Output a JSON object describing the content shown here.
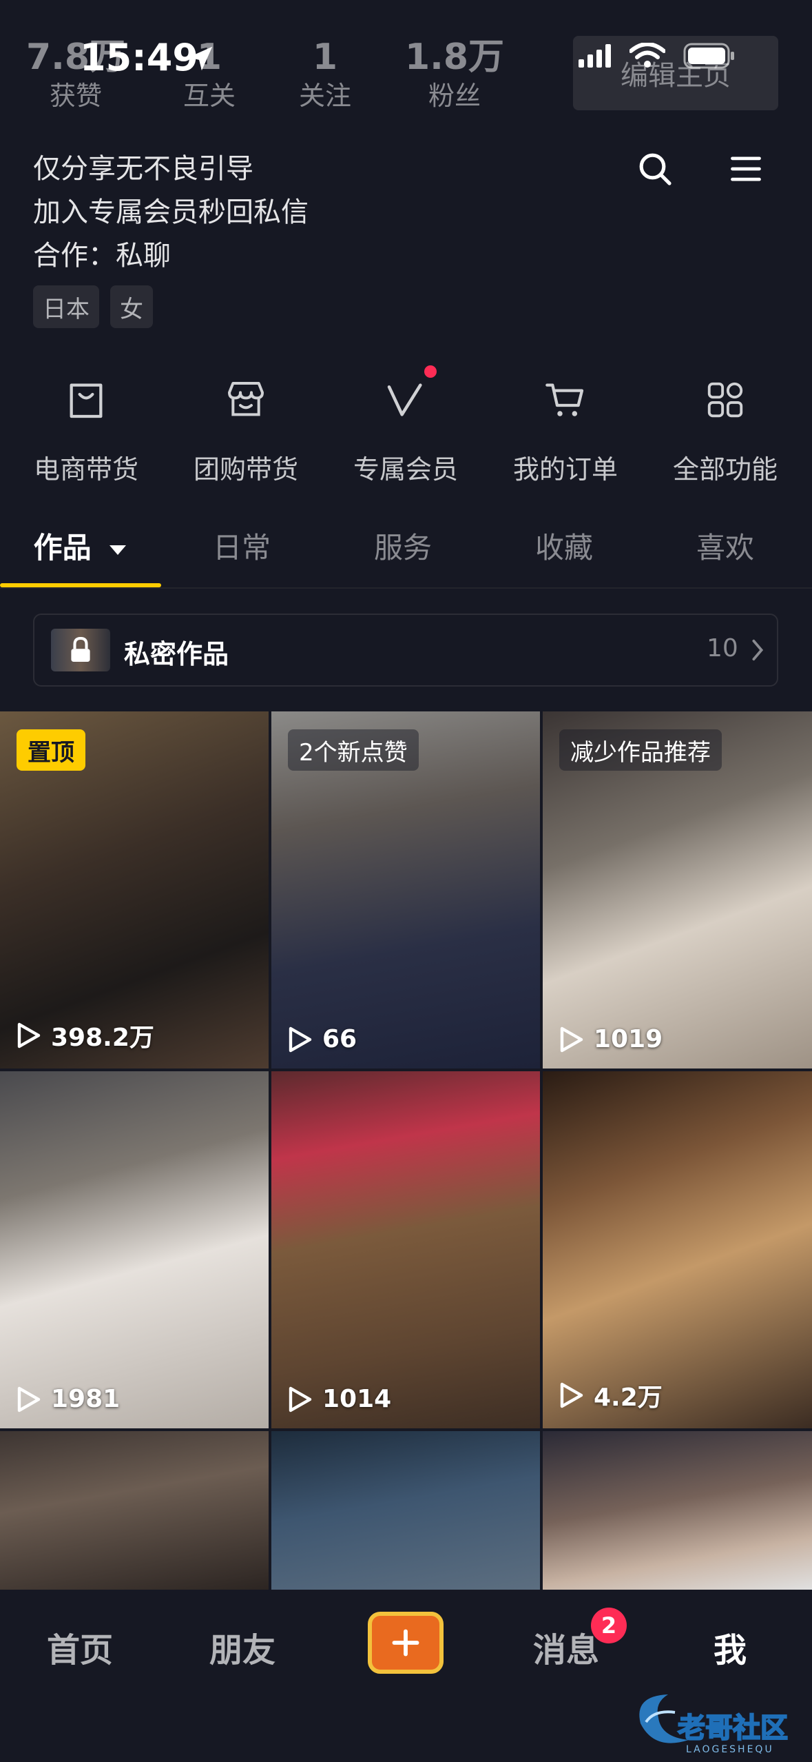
{
  "status_bar": {
    "time": "15:49"
  },
  "stats": [
    {
      "num": "7.8万",
      "label": "获赞"
    },
    {
      "num": "1",
      "label": "互关"
    },
    {
      "num": "1",
      "label": "关注"
    },
    {
      "num": "1.8万",
      "label": "粉丝"
    }
  ],
  "edit_button": "编辑主页",
  "bio": {
    "lines": [
      "仅分享无不良引导",
      "加入专属会员秒回私信",
      "合作：私聊"
    ],
    "tags": [
      "日本",
      "女"
    ]
  },
  "features": [
    {
      "label": "电商带货",
      "icon": "shopping-bag-icon"
    },
    {
      "label": "团购带货",
      "icon": "store-icon"
    },
    {
      "label": "专属会员",
      "icon": "vip-icon"
    },
    {
      "label": "我的订单",
      "icon": "cart-icon"
    },
    {
      "label": "全部功能",
      "icon": "grid-icon"
    }
  ],
  "tabs": [
    "作品",
    "日常",
    "服务",
    "收藏",
    "喜欢"
  ],
  "private_works": {
    "label": "私密作品",
    "count": "10"
  },
  "videos": [
    {
      "badge": "置顶",
      "plays": "398.2万"
    },
    {
      "badge": "2个新点赞",
      "plays": "66"
    },
    {
      "badge": "减少作品推荐",
      "plays": "1019"
    },
    {
      "badge": "",
      "plays": "1981"
    },
    {
      "badge": "",
      "plays": "1014"
    },
    {
      "badge": "",
      "plays": "4.2万"
    }
  ],
  "bottom_nav": {
    "home": "首页",
    "friends": "朋友",
    "messages": "消息",
    "messages_badge": "2",
    "me": "我"
  },
  "colors": {
    "accent": "#fecc00",
    "badge_red": "#fe2c55",
    "background": "#161823"
  }
}
